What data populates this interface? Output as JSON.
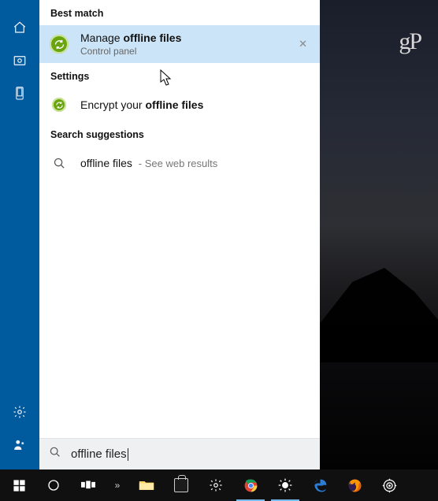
{
  "watermark": "gP",
  "groups": {
    "best_match": "Best match",
    "settings": "Settings",
    "search_suggestions": "Search suggestions"
  },
  "results": {
    "manage": {
      "prefix": "Manage ",
      "bold": "offline files",
      "subtitle": "Control panel"
    },
    "encrypt": {
      "prefix": "Encrypt your ",
      "bold": "offline files"
    },
    "web": {
      "query": "offline files",
      "hint": "- See web results"
    }
  },
  "search": {
    "value": "offline files"
  }
}
